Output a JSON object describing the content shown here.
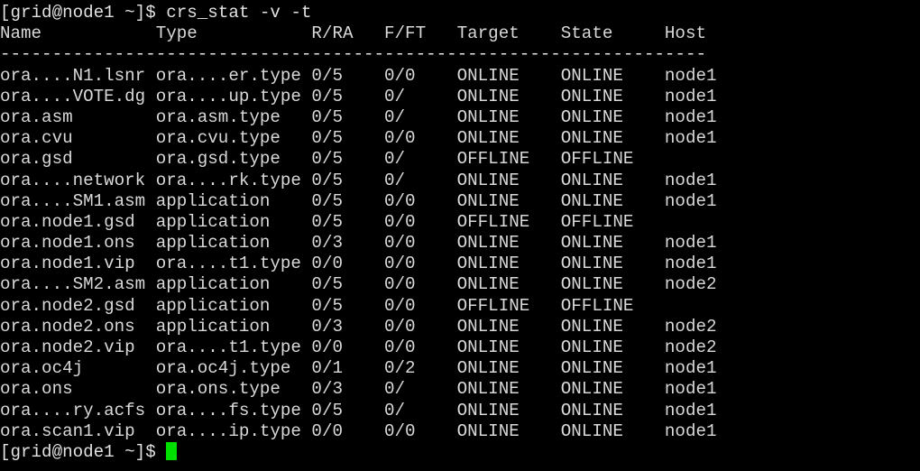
{
  "terminal": {
    "shell_prompt": "[grid@node1 ~]$ ",
    "command": "crs_stat -v -t",
    "prompt_line": "[grid@node1 ~]$ crs_stat -v -t",
    "final_prompt": "[grid@node1 ~]$ ",
    "cursor": {
      "name": "block-cursor",
      "color": "#00e000",
      "visible": true
    },
    "colors": {
      "background": "#000000",
      "foreground": "#d9d9d9",
      "cursor": "#00e000"
    },
    "columns": {
      "name": 0,
      "type": 15,
      "r_ra": 30,
      "f_ft": 37,
      "target": 44,
      "state": 54,
      "host": 64
    },
    "header": {
      "name": "Name",
      "type": "Type",
      "r_ra": "R/RA",
      "f_ft": "F/FT",
      "target": "Target",
      "state": "State",
      "host": "Host"
    },
    "separator": "--------------------------------------------------------------------",
    "rows": [
      {
        "name": "ora....N1.lsnr",
        "type": "ora....er.type",
        "r_ra": "0/5",
        "f_ft": "0/0",
        "target": "ONLINE",
        "state": "ONLINE",
        "host": "node1"
      },
      {
        "name": "ora....VOTE.dg",
        "type": "ora....up.type",
        "r_ra": "0/5",
        "f_ft": "0/",
        "target": "ONLINE",
        "state": "ONLINE",
        "host": "node1"
      },
      {
        "name": "ora.asm",
        "type": "ora.asm.type",
        "r_ra": "0/5",
        "f_ft": "0/",
        "target": "ONLINE",
        "state": "ONLINE",
        "host": "node1"
      },
      {
        "name": "ora.cvu",
        "type": "ora.cvu.type",
        "r_ra": "0/5",
        "f_ft": "0/0",
        "target": "ONLINE",
        "state": "ONLINE",
        "host": "node1"
      },
      {
        "name": "ora.gsd",
        "type": "ora.gsd.type",
        "r_ra": "0/5",
        "f_ft": "0/",
        "target": "OFFLINE",
        "state": "OFFLINE",
        "host": ""
      },
      {
        "name": "ora....network",
        "type": "ora....rk.type",
        "r_ra": "0/5",
        "f_ft": "0/",
        "target": "ONLINE",
        "state": "ONLINE",
        "host": "node1"
      },
      {
        "name": "ora....SM1.asm",
        "type": "application",
        "r_ra": "0/5",
        "f_ft": "0/0",
        "target": "ONLINE",
        "state": "ONLINE",
        "host": "node1"
      },
      {
        "name": "ora.node1.gsd",
        "type": "application",
        "r_ra": "0/5",
        "f_ft": "0/0",
        "target": "OFFLINE",
        "state": "OFFLINE",
        "host": ""
      },
      {
        "name": "ora.node1.ons",
        "type": "application",
        "r_ra": "0/3",
        "f_ft": "0/0",
        "target": "ONLINE",
        "state": "ONLINE",
        "host": "node1"
      },
      {
        "name": "ora.node1.vip",
        "type": "ora....t1.type",
        "r_ra": "0/0",
        "f_ft": "0/0",
        "target": "ONLINE",
        "state": "ONLINE",
        "host": "node1"
      },
      {
        "name": "ora....SM2.asm",
        "type": "application",
        "r_ra": "0/5",
        "f_ft": "0/0",
        "target": "ONLINE",
        "state": "ONLINE",
        "host": "node2"
      },
      {
        "name": "ora.node2.gsd",
        "type": "application",
        "r_ra": "0/5",
        "f_ft": "0/0",
        "target": "OFFLINE",
        "state": "OFFLINE",
        "host": ""
      },
      {
        "name": "ora.node2.ons",
        "type": "application",
        "r_ra": "0/3",
        "f_ft": "0/0",
        "target": "ONLINE",
        "state": "ONLINE",
        "host": "node2"
      },
      {
        "name": "ora.node2.vip",
        "type": "ora....t1.type",
        "r_ra": "0/0",
        "f_ft": "0/0",
        "target": "ONLINE",
        "state": "ONLINE",
        "host": "node2"
      },
      {
        "name": "ora.oc4j",
        "type": "ora.oc4j.type",
        "r_ra": "0/1",
        "f_ft": "0/2",
        "target": "ONLINE",
        "state": "ONLINE",
        "host": "node1"
      },
      {
        "name": "ora.ons",
        "type": "ora.ons.type",
        "r_ra": "0/3",
        "f_ft": "0/",
        "target": "ONLINE",
        "state": "ONLINE",
        "host": "node1"
      },
      {
        "name": "ora....ry.acfs",
        "type": "ora....fs.type",
        "r_ra": "0/5",
        "f_ft": "0/",
        "target": "ONLINE",
        "state": "ONLINE",
        "host": "node1"
      },
      {
        "name": "ora.scan1.vip",
        "type": "ora....ip.type",
        "r_ra": "0/0",
        "f_ft": "0/0",
        "target": "ONLINE",
        "state": "ONLINE",
        "host": "node1"
      }
    ]
  }
}
